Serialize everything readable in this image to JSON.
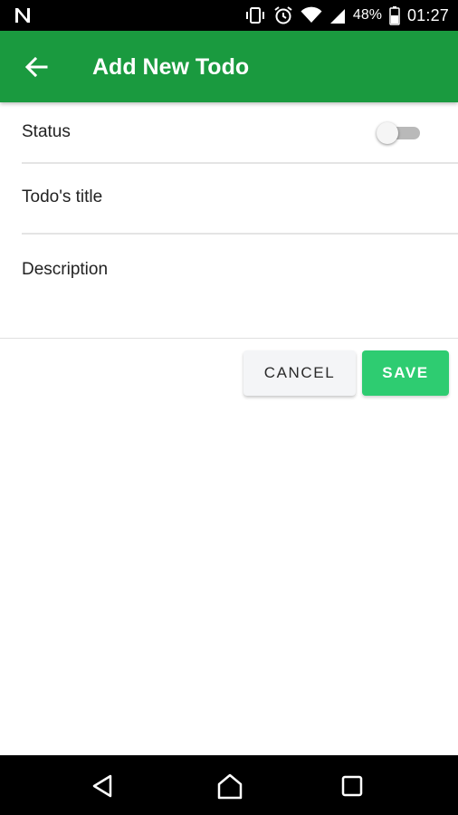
{
  "status_bar": {
    "battery_percent": "48%",
    "time": "01:27",
    "icons": [
      "notification-n-icon",
      "vibrate-icon",
      "alarm-icon",
      "wifi-icon",
      "signal-icon",
      "battery-icon"
    ]
  },
  "app_bar": {
    "title": "Add New Todo",
    "back_icon": "arrow-left-icon",
    "color": "#1a9a3f"
  },
  "form": {
    "status_label": "Status",
    "status_on": false,
    "title_placeholder": "Todo's title",
    "description_placeholder": "Description"
  },
  "actions": {
    "cancel_label": "CANCEL",
    "save_label": "SAVE",
    "save_color": "#2ecc71"
  },
  "nav_bar": {
    "icons": [
      "back-triangle-icon",
      "home-icon",
      "recents-icon"
    ]
  }
}
